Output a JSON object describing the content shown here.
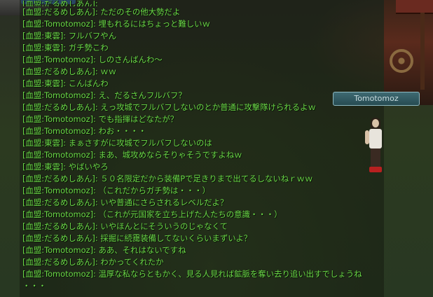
{
  "nameplate": "Tomotomoz",
  "chat_lines": [
    "[血盟:だるめしあん]: ",
    "[血盟:だるめしあん]: ただのその他大勢だよ",
    "[血盟:Tomotomoz]: 埋もれるにはちょっと難しいｗ",
    "[血盟:東雲]: フルバフやん",
    "[血盟:東雲]: ガチ勢こわ",
    "[血盟:Tomotomoz]: しのさんばんわ～",
    "[血盟:だるめしあん]: ｗｗ",
    "[血盟:東雲]: こんばんわ",
    "[血盟:Tomotomoz]: え、だるさんフルバフ？",
    "[血盟:だるめしあん]: えっ攻城でフルバフしないのとか普通に攻撃隊けられるよｗ",
    "[血盟:Tomotomoz]: でも指揮はどなたが？",
    "[血盟:Tomotomoz]: わお・・・・",
    "[血盟:東雲]: まぁさすがに攻城でフルバフしないのは",
    "[血盟:Tomotomoz]: まあ、城攻めならそりゃそうですよねｗ",
    "[血盟:東雲]: やばいやろ",
    "[血盟:だるめしあん]: ５０名限定だから装備Pで足きりまで出てるしないねｒｗｗ",
    "[血盟:Tomotomoz]: （これだからガチ勢は・・・）",
    "[血盟:だるめしあん]: いや普通にさらされるレベルだよ？",
    "[血盟:Tomotomoz]: （これが元国家を立ち上げた人たちの意識・・・）",
    "[血盟:だるめしあん]: いやほんとにそういうのじゃなくて",
    "[血盟:だるめしあん]: 採掘に続靄装備してないくらいまずいよ？",
    "[血盟:Tomotomoz]: ああ、それはないですね",
    "[血盟:だるめしあん]: わかってくれたか",
    "[血盟:Tomotomoz]: 温厚な私ならともかく、見る人見れば鉱脈を奪い去り追い出すでしょうね",
    "・・・"
  ],
  "colors": {
    "chat_text": "#6edc4a",
    "nameplate_bg": "#3e6a72"
  }
}
